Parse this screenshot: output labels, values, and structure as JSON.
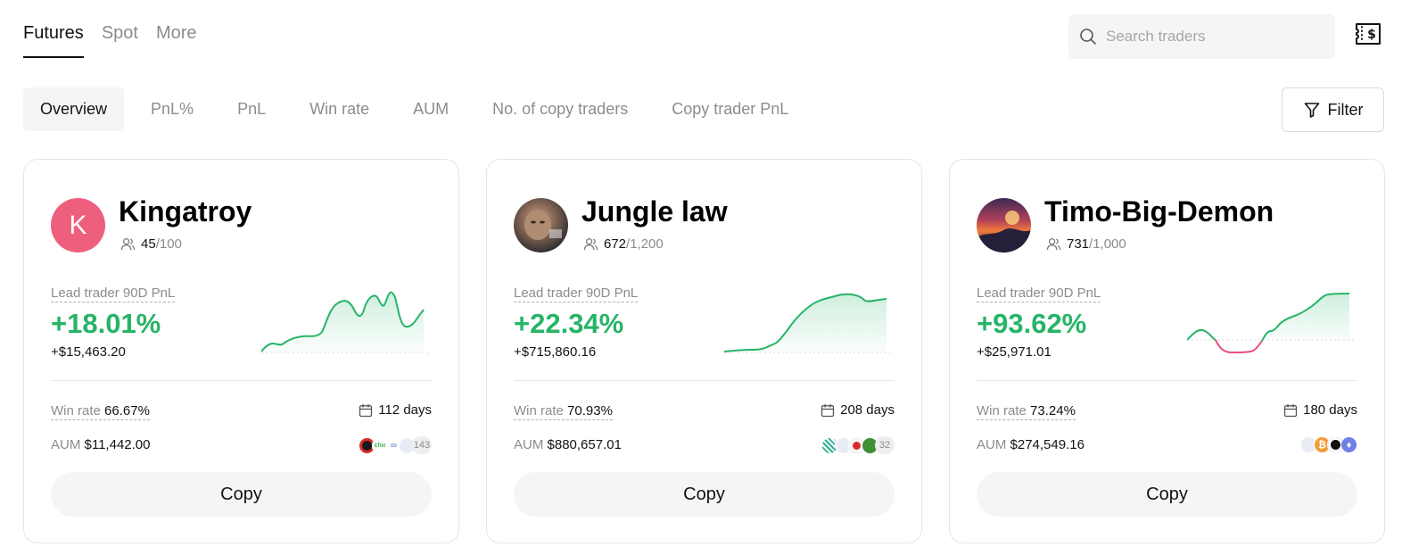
{
  "top_tabs": [
    {
      "label": "Futures",
      "active": true
    },
    {
      "label": "Spot",
      "active": false
    },
    {
      "label": "More",
      "active": false
    }
  ],
  "search": {
    "placeholder": "Search traders",
    "icon": "search-icon"
  },
  "header_icon": "wallet-dollar-icon",
  "filter_tabs": [
    {
      "label": "Overview",
      "active": true
    },
    {
      "label": "PnL%",
      "active": false
    },
    {
      "label": "PnL",
      "active": false
    },
    {
      "label": "Win rate",
      "active": false
    },
    {
      "label": "AUM",
      "active": false
    },
    {
      "label": "No. of copy traders",
      "active": false
    },
    {
      "label": "Copy trader PnL",
      "active": false
    }
  ],
  "filter_button": {
    "label": "Filter",
    "icon": "funnel-icon"
  },
  "colors": {
    "positive": "#26b467",
    "negative": "#e8507a",
    "avatar_k": "#ee5f7d"
  },
  "cards": [
    {
      "name": "Kingatroy",
      "avatar_letter": "K",
      "followers": "45",
      "followers_max": "/100",
      "pnl_label": "Lead trader 90D PnL",
      "pnl_pct": "+18.01%",
      "pnl_abs": "+$15,463.20",
      "win_rate_label": "Win rate",
      "win_rate": "66.67%",
      "days": "112 days",
      "aum_label": "AUM",
      "aum": "$11,442.00",
      "coin_count": "143",
      "copy_label": "Copy"
    },
    {
      "name": "Jungle law",
      "avatar_letter": "",
      "followers": "672",
      "followers_max": "/1,200",
      "pnl_label": "Lead trader 90D PnL",
      "pnl_pct": "+22.34%",
      "pnl_abs": "+$715,860.16",
      "win_rate_label": "Win rate",
      "win_rate": "70.93%",
      "days": "208 days",
      "aum_label": "AUM",
      "aum": "$880,657.01",
      "coin_count": "32",
      "copy_label": "Copy"
    },
    {
      "name": "Timo-Big-Demon",
      "avatar_letter": "",
      "followers": "731",
      "followers_max": "/1,000",
      "pnl_label": "Lead trader 90D PnL",
      "pnl_pct": "+93.62%",
      "pnl_abs": "+$25,971.01",
      "win_rate_label": "Win rate",
      "win_rate": "73.24%",
      "days": "180 days",
      "aum_label": "AUM",
      "aum": "$274,549.16",
      "coin_count": "",
      "copy_label": "Copy"
    }
  ]
}
